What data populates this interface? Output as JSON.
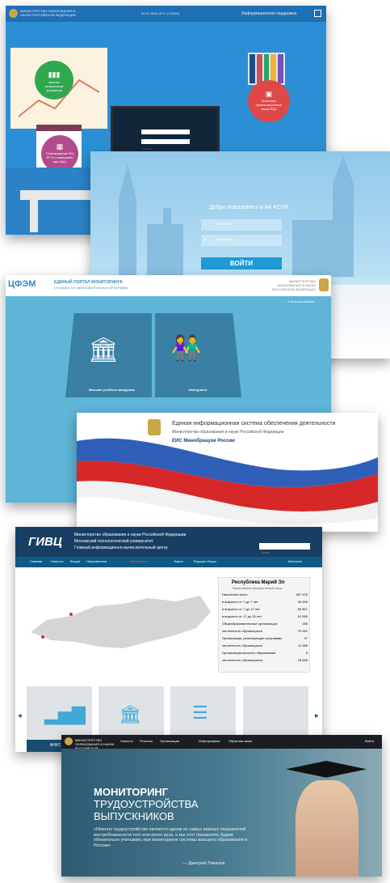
{
  "shots": {
    "s1": {
      "ministry": "МИНИСТЕРСТВО ОБРАЗОВАНИЯ И НАУКИ РОССИЙСКОЙ ФЕДЕРАЦИИ",
      "datetime": "21.11.2016 13:17 (+03:00)",
      "support": "Информационная поддержка",
      "board_left_label": "Анализ результатов экзаменов",
      "board_right_label": "Отчетные организационные связи ФЦС",
      "calendar_label": "Планирование ФЦ ЕГЭ и совещания при ЦЦС",
      "login_field": "Логин",
      "password_field": "Пароль"
    },
    "s2": {
      "welcome": "Добро пожаловать в АК КСУИ",
      "login_placeholder": "Ваш логин",
      "password_placeholder": "Ваш пароль",
      "submit": "ВОЙТИ"
    },
    "s3": {
      "logo": "ЦФЭМ",
      "title": "ЕДИНЫЙ ПОРТАЛ МОНИТОРИНГА",
      "subtitle": "СТОИМОСТИ ОБРАЗОВАТЕЛЬНЫХ ПРОГРАММ",
      "ministry": "МИНИСТЕРСТВО ОБРАЗОВАНИЯ И НАУКИ РОССИЙСКОЙ ФЕДЕРАЦИИ",
      "cabinet": "Личный кабинет",
      "tile_universities": "Высшие учебные заведения",
      "tile_applicant": "Абитуриент"
    },
    "s4": {
      "line1": "Единая информационная система обеспечения деятельности",
      "line2": "Министерства образования и науки Российской Федерации",
      "line3": "ЕИС Минобрнауки России"
    },
    "s5": {
      "logo": "ГИВЦ",
      "org1": "Министерство образования и науки Российской Федерации",
      "org2": "Московский технологический университет",
      "org3": "Главный информационно-вычислительный центр",
      "search_placeholder": "Поиск",
      "nav": [
        "Главная",
        "Новости",
        "Форум",
        "Направления",
        "Мониторинг",
        "Карта",
        "Текущие сборы",
        "Контакты"
      ],
      "region_title": "Республика Марий Эл",
      "region_district": "Приволжский федеральный округ",
      "stats": [
        {
          "label": "Население всего",
          "value": "687 575"
        },
        {
          "label": "в возрасте от 7 до 7 лет",
          "value": "34 699"
        },
        {
          "label": "в возрасте от 7 до 17 лет",
          "value": "69 807"
        },
        {
          "label": "в возрасте от 17 до 25 лет",
          "value": "61 556"
        },
        {
          "label": "Общеобразовательные организации",
          "value": "268"
        },
        {
          "label": "численность обучающихся",
          "value": "70 542"
        },
        {
          "label": "Организации, реализующие программы",
          "value": "37"
        },
        {
          "label": "численность обучающихся",
          "value": "11 566"
        },
        {
          "label": "Организации высшего образования",
          "value": "8"
        },
        {
          "label": "численность обучающихся",
          "value": "18 636"
        }
      ],
      "tile_label": "ФИКС »ЕГ"
    },
    "s6": {
      "ministry": "МИНИСТЕРСТВО ОБРАЗОВАНИЯ И НАУКИ РОССИЙСКОЙ ФЕДЕРАЦИИ",
      "nav": [
        "Новости",
        "Регионы",
        "Организации",
        "Инфографика",
        "Обратная связь"
      ],
      "login": "Войти",
      "h1": "МОНИТОРИНГ",
      "h2": "ТРУДОУСТРОЙСТВА",
      "h3": "ВЫПУСКНИКОВ",
      "quote": "«Именно трудоустройство является одним из самых важных показателей востребованности того или иного вуза, и мы этот показатель будем обязательно учитывать при мониторинге системы высшего образования в России»",
      "author": "— Дмитрий Ливанов"
    }
  }
}
